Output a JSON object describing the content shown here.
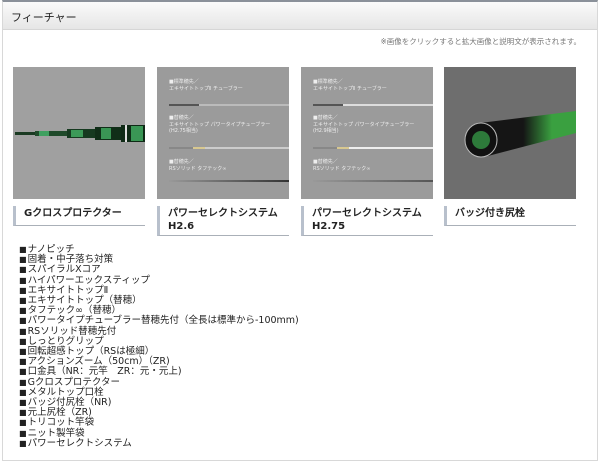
{
  "header": {
    "title": "フィーチャー"
  },
  "note": "※画像をクリックすると拡大画像と説明文が表示されます。",
  "cards": [
    {
      "caption": "Gクロスプロテクター",
      "image": "g-cross-protector"
    },
    {
      "caption_line1": "パワーセレクトシステム",
      "caption_line2": "H2.6",
      "specs": [
        "■標準穂先／",
        "エキサイトトップⅡ チューブラー",
        "■替穂先／",
        "エキサイトトップ パワータイプチューブラー",
        "(H2.75相当)",
        "■替穂先／",
        "RSソリッド タフテック∞"
      ]
    },
    {
      "caption_line1": "パワーセレクトシステム",
      "caption_line2": "H2.75",
      "specs": [
        "■標準穂先／",
        "エキサイトトップⅡ チューブラー",
        "■替穂先／",
        "エキサイトトップ パワータイプチューブラー",
        "(H2.9相当)",
        "■替穂先／",
        "RSソリッド タフテック∞"
      ]
    },
    {
      "caption": "バッジ付き尻栓",
      "image": "badge-butt-cap"
    }
  ],
  "features": [
    "ナノピッチ",
    "固着・中子落ち対策",
    "スパイラルXコア",
    "ハイパワーエックスティップ",
    "エキサイトトップⅡ",
    "エキサイトトップ（替穂）",
    "タフテック∞（替穂）",
    "パワータイプチューブラー替穂先付（全長は標準から-100mm)",
    "RSソリッド替穂先付",
    "しっとりグリップ",
    "回転超感トップ（RSは極細）",
    "アクションズーム（50cm）（ZR)",
    "口金具（NR：元竿　ZR：元・元上)",
    "Gクロスプロテクター",
    "メタルトップ口栓",
    "バッジ付尻栓（NR)",
    "元上尻栓（ZR)",
    "トリコット竿袋",
    "ニット製竿袋",
    "パワーセレクトシステム"
  ]
}
